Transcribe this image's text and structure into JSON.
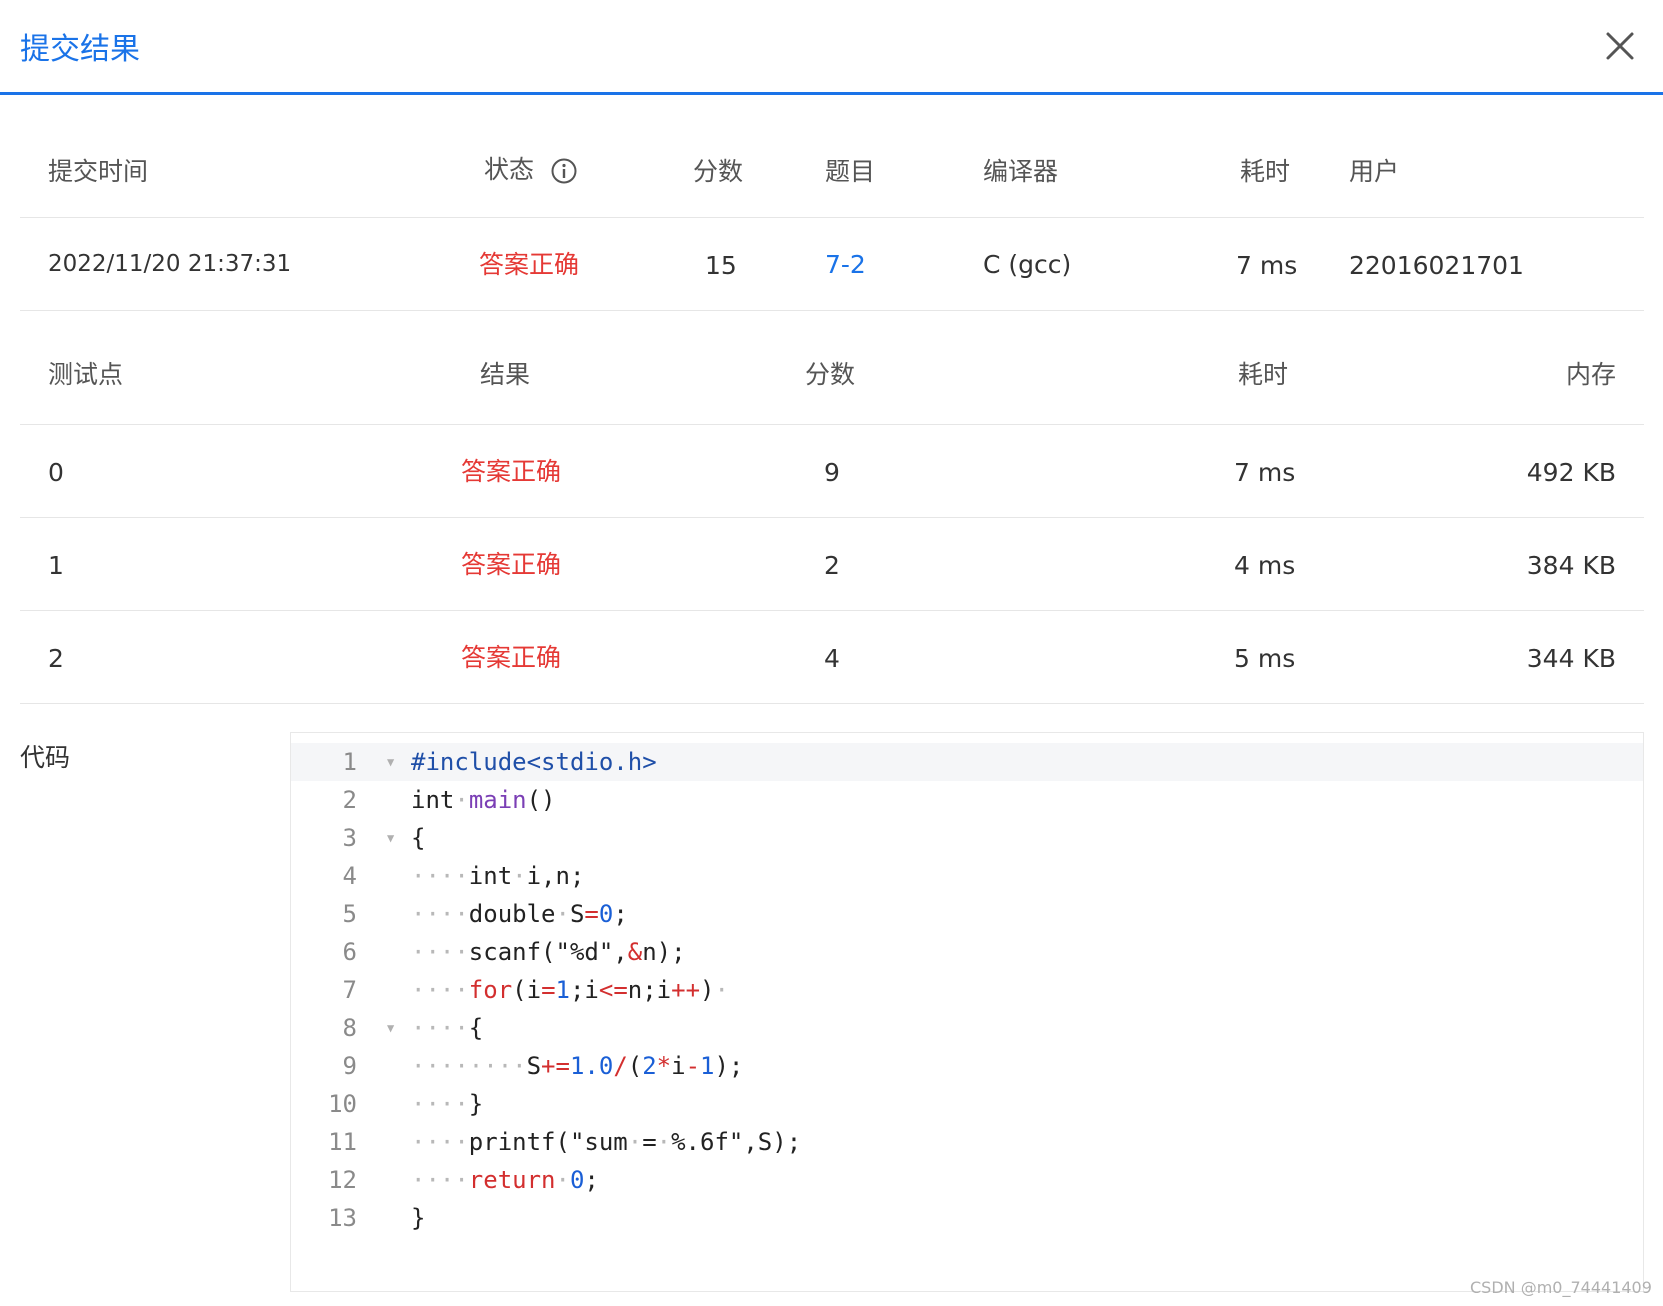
{
  "dialog": {
    "title": "提交结果",
    "close_label": "×"
  },
  "summary": {
    "headers": [
      "提交时间",
      "状态",
      "分数",
      "题目",
      "编译器",
      "耗时",
      "用户"
    ],
    "row": {
      "time": "2022/11/20 21:37:31",
      "status": "答案正确",
      "score": "15",
      "problem": "7-2",
      "compiler": "C (gcc)",
      "duration": "7 ms",
      "user": "22016021701"
    }
  },
  "tests": {
    "headers": [
      "测试点",
      "结果",
      "分数",
      "耗时",
      "内存"
    ],
    "rows": [
      {
        "id": "0",
        "result": "答案正确",
        "score": "9",
        "time": "7 ms",
        "memory": "492 KB"
      },
      {
        "id": "1",
        "result": "答案正确",
        "score": "2",
        "time": "4 ms",
        "memory": "384 KB"
      },
      {
        "id": "2",
        "result": "答案正确",
        "score": "4",
        "time": "5 ms",
        "memory": "344 KB"
      }
    ]
  },
  "code": {
    "label": "代码",
    "line_numbers": [
      "1",
      "2",
      "3",
      "4",
      "5",
      "6",
      "7",
      "8",
      "9",
      "10",
      "11",
      "12",
      "13"
    ],
    "tokens": [
      [
        "#include<stdio.h>"
      ],
      [
        "int",
        "·",
        "main",
        "()"
      ],
      [
        "{"
      ],
      [
        "····",
        "int",
        "·",
        "i,n;"
      ],
      [
        "····",
        "double",
        "·",
        "S",
        "=",
        "0",
        ";"
      ],
      [
        "····",
        "scanf(\"%d\",",
        "&",
        "n);"
      ],
      [
        "····",
        "for",
        "(i",
        "=",
        "1",
        ";i",
        "<=",
        "n;i",
        "++",
        ")",
        "·"
      ],
      [
        "····",
        "{"
      ],
      [
        "········",
        "S",
        "+=",
        "1.0",
        "/",
        "(",
        "2",
        "*",
        "i",
        "-",
        "1",
        ");"
      ],
      [
        "····",
        "}"
      ],
      [
        "····",
        "printf(\"sum",
        "·",
        "=",
        "·",
        "%.6f\",S);"
      ],
      [
        "····",
        "return",
        "·",
        "0",
        ";"
      ],
      [
        "}"
      ]
    ]
  },
  "watermark": "CSDN @m0_74441409",
  "colors": {
    "accent": "#1a73e8",
    "success_text": "#e53935"
  }
}
